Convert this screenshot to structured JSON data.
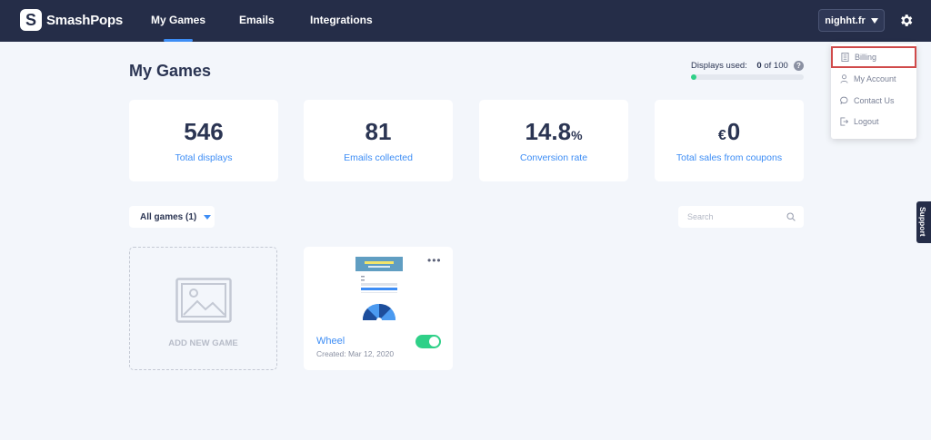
{
  "app": {
    "logo_letter": "S",
    "name": "SmashPops"
  },
  "nav": {
    "items": [
      "My Games",
      "Emails",
      "Integrations"
    ],
    "active": "My Games"
  },
  "account": {
    "site": "nighht.fr"
  },
  "settings_menu": {
    "items": [
      {
        "label": "Billing",
        "icon": "receipt-icon",
        "highlighted": true
      },
      {
        "label": "My Account",
        "icon": "user-icon"
      },
      {
        "label": "Contact Us",
        "icon": "chat-bubble-icon"
      },
      {
        "label": "Logout",
        "icon": "logout-icon"
      }
    ]
  },
  "page": {
    "title": "My Games"
  },
  "usage": {
    "label": "Displays used:",
    "used": "0",
    "of_text": "of 100",
    "help": "?",
    "fill_fraction": 0.05
  },
  "stats": [
    {
      "value": "546",
      "suffix": "",
      "prefix": "",
      "label": "Total displays"
    },
    {
      "value": "81",
      "suffix": "",
      "prefix": "",
      "label": "Emails collected"
    },
    {
      "value": "14.8",
      "suffix": "%",
      "prefix": "",
      "label": "Conversion rate"
    },
    {
      "value": "0",
      "suffix": "",
      "prefix": "€",
      "label": "Total sales from coupons"
    }
  ],
  "filter": {
    "label": "All games (1)"
  },
  "search": {
    "placeholder": "Search"
  },
  "add_game": {
    "label": "ADD NEW GAME"
  },
  "games": [
    {
      "name": "Wheel",
      "created": "Created: Mar 12, 2020",
      "enabled": true,
      "more": "•••"
    }
  ],
  "support": {
    "label": "Support"
  },
  "colors": {
    "nav_bg": "#252d48",
    "accent": "#3d8df5",
    "success": "#2fd088",
    "highlight": "#d04a4a"
  }
}
